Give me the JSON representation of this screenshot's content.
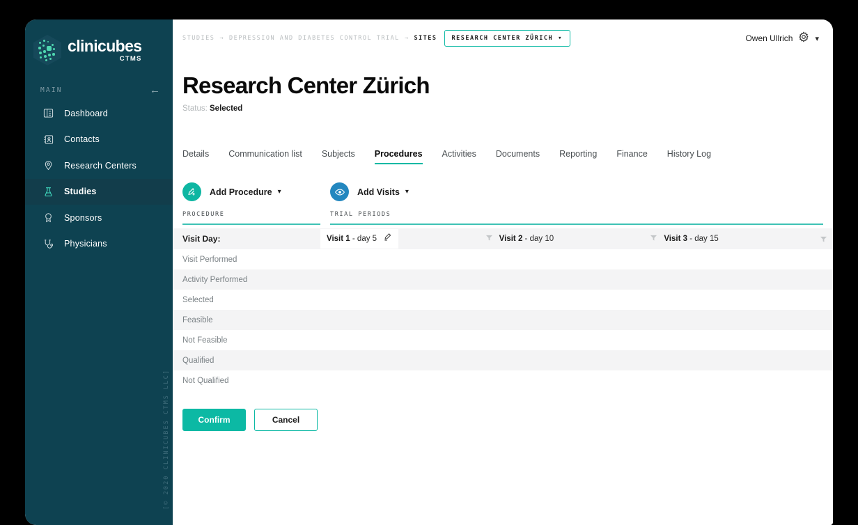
{
  "brand": {
    "name": "clinicubes",
    "subtitle": "CTMS",
    "logo_icon": "hex-cube-logo"
  },
  "sidebar": {
    "section_title": "MAIN",
    "collapse_icon": "arrow-left-icon",
    "copyright": "[© 2020 CLINICUBES CTMS LLC]",
    "bg_color": "#0e4251",
    "active_bg_color": "#123d4b",
    "items": [
      {
        "label": "Dashboard",
        "icon": "dashboard-icon",
        "active": false
      },
      {
        "label": "Contacts",
        "icon": "contacts-icon",
        "active": false
      },
      {
        "label": "Research Centers",
        "icon": "map-pin-icon",
        "active": false
      },
      {
        "label": "Studies",
        "icon": "flask-icon",
        "active": true
      },
      {
        "label": "Sponsors",
        "icon": "award-icon",
        "active": false
      },
      {
        "label": "Physicians",
        "icon": "stethoscope-icon",
        "active": false
      }
    ]
  },
  "topbar": {
    "breadcrumb": {
      "items": [
        "STUDIES",
        "DEPRESSION AND DIABETES CONTROL TRIAL",
        "SITES"
      ],
      "separator": "→",
      "current_chip": "RESEARCH CENTER ZÜRICH",
      "chip_caret_icon": "chevron-down-icon",
      "chip_border_color": "#0cb9a4"
    },
    "user": {
      "name": "Owen Ullrich",
      "settings_icon": "gear-icon",
      "caret_icon": "chevron-down-icon"
    }
  },
  "page": {
    "title": "Research Center Zürich",
    "status_label": "Status:",
    "status_value": "Selected"
  },
  "tabs": [
    {
      "label": "Details",
      "active": false
    },
    {
      "label": "Communication list",
      "active": false
    },
    {
      "label": "Subjects",
      "active": false
    },
    {
      "label": "Procedures",
      "active": true
    },
    {
      "label": "Activities",
      "active": false
    },
    {
      "label": "Documents",
      "active": false
    },
    {
      "label": "Reporting",
      "active": false
    },
    {
      "label": "Finance",
      "active": false
    },
    {
      "label": "History Log",
      "active": false
    }
  ],
  "actions": {
    "add_procedure": {
      "label": "Add Procedure",
      "icon": "pen-plus-icon",
      "caret_icon": "chevron-down-icon",
      "color": "#0eb6a2"
    },
    "add_visits": {
      "label": "Add Visits",
      "icon": "eye-icon",
      "caret_icon": "chevron-down-icon",
      "color": "#2387bf"
    }
  },
  "table": {
    "col_head_procedure": "PROCEDURE",
    "col_head_trial_periods": "TRIAL PERIODS",
    "underline_color": "#3ec2b5",
    "visit_day_label": "Visit Day:",
    "visits": [
      {
        "name": "Visit 1",
        "day": "day 5",
        "separator": "-",
        "editable": true,
        "edit_icon": "pencil-icon",
        "filter_icon": "filter-icon"
      },
      {
        "name": "Visit 2",
        "day": "day 10",
        "separator": "-",
        "editable": false,
        "filter_icon": "filter-icon"
      },
      {
        "name": "Visit 3",
        "day": "day 15",
        "separator": "-",
        "editable": false,
        "filter_icon": "filter-icon"
      }
    ],
    "rows": [
      "Visit Performed",
      "Activity Performed",
      "Selected",
      "Feasible",
      "Not Feasible",
      "Qualified",
      "Not Qualified"
    ]
  },
  "footer": {
    "confirm_label": "Confirm",
    "cancel_label": "Cancel",
    "accent_color": "#0cb9a4"
  }
}
